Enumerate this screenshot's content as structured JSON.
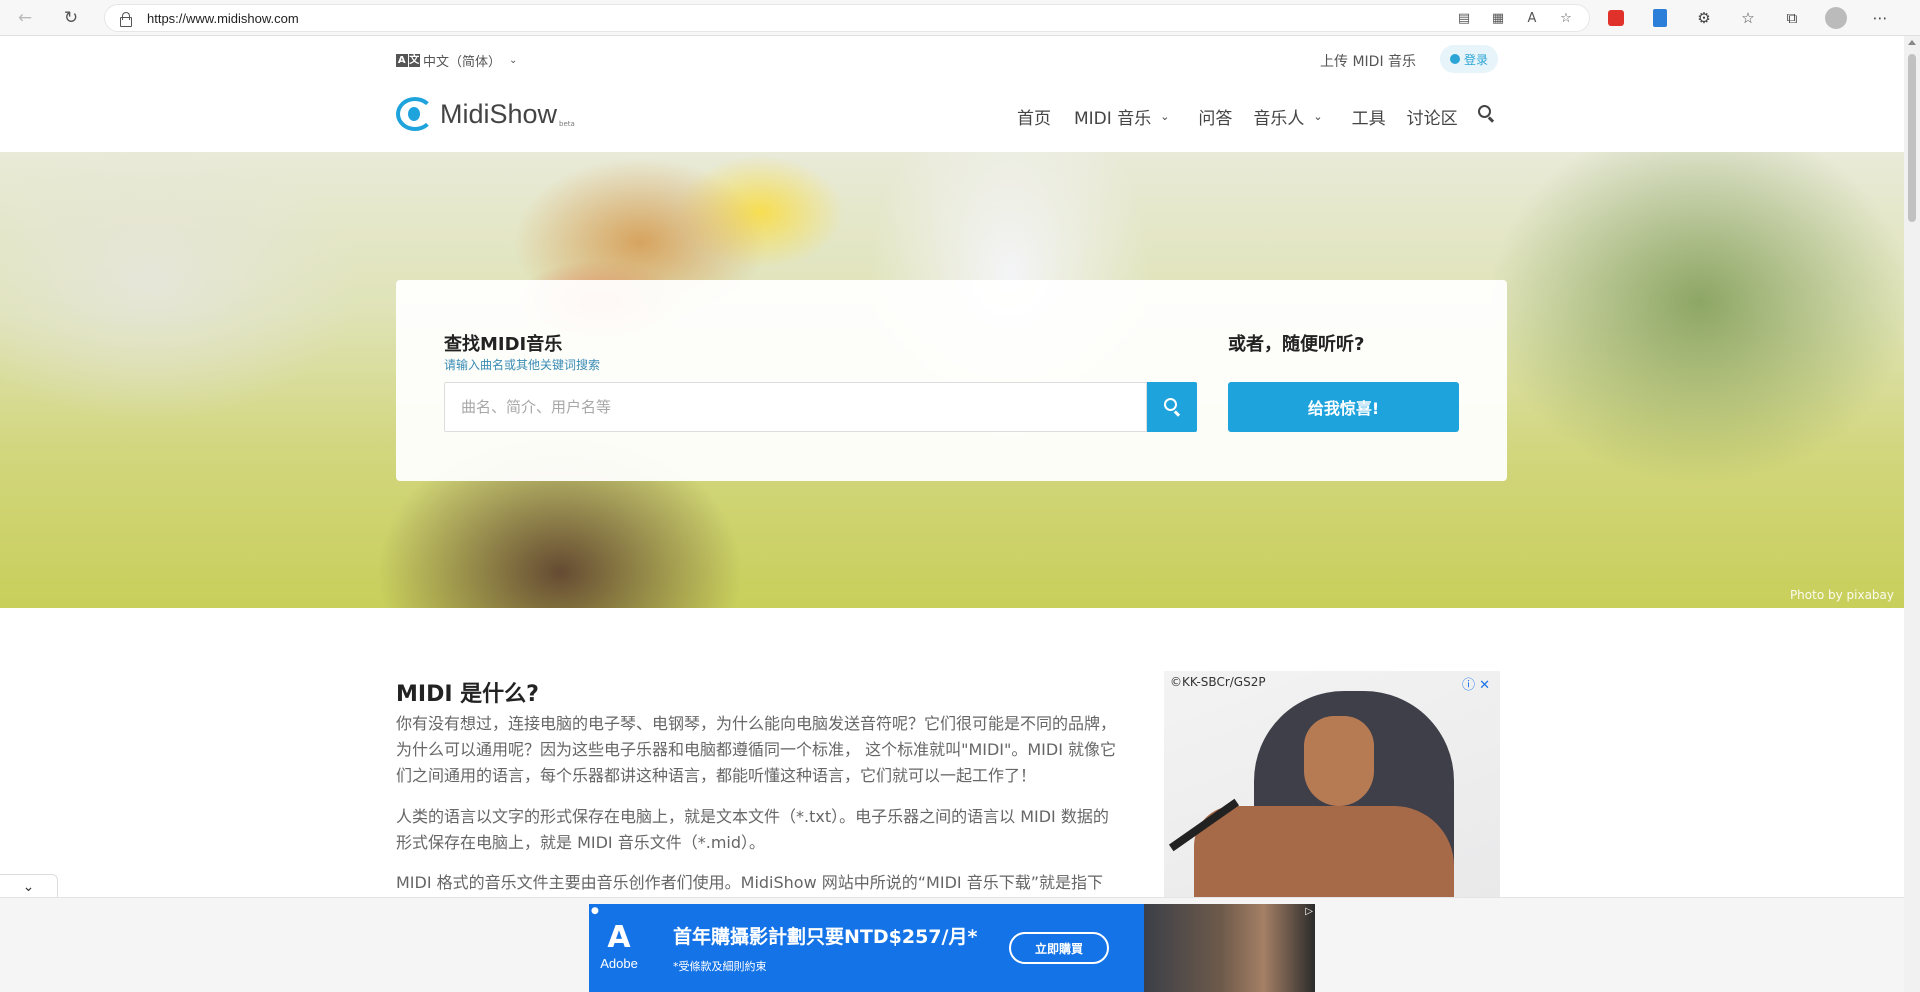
{
  "browser": {
    "url": "https://www.midishow.com",
    "icons": [
      "back-icon",
      "refresh-icon",
      "lock-icon",
      "immersive-reader-icon",
      "qr-icon",
      "read-aloud-icon",
      "favorite-add-icon",
      "extension-red-icon",
      "extension-blue-icon",
      "extensions-icon",
      "favorites-icon",
      "collections-icon",
      "profile-icon",
      "more-icon"
    ]
  },
  "topbar": {
    "language": "中文（简体）",
    "upload": "上传 MIDI 音乐",
    "login": "登录"
  },
  "logo": {
    "name": "MidiShow",
    "badge": "beta"
  },
  "nav": {
    "items": [
      {
        "label": "首页",
        "dropdown": false
      },
      {
        "label": "MIDI 音乐",
        "dropdown": true
      },
      {
        "label": "问答",
        "dropdown": false
      },
      {
        "label": "音乐人",
        "dropdown": true
      },
      {
        "label": "工具",
        "dropdown": false
      },
      {
        "label": "讨论区",
        "dropdown": false
      }
    ]
  },
  "hero": {
    "credit": "Photo by pixabay",
    "search_title": "查找MIDI音乐",
    "search_subtitle": "请输入曲名或其他关键词搜索",
    "search_placeholder": "曲名、简介、用户名等",
    "random_title": "或者，随便听听?",
    "random_button": "给我惊喜!"
  },
  "content": {
    "title": "MIDI 是什么?",
    "paragraphs": [
      "你有没有想过，连接电脑的电子琴、电钢琴，为什么能向电脑发送音符呢？它们很可能是不同的品牌，为什么可以通用呢？因为这些电子乐器和电脑都遵循同一个标准， 这个标准就叫\"MIDI\"。MIDI 就像它们之间通用的语言，每个乐器都讲这种语言，都能听懂这种语言，它们就可以一起工作了！",
      "人类的语言以文字的形式保存在电脑上，就是文本文件（*.txt）。电子乐器之间的语言以 MIDI 数据的形式保存在电脑上，就是 MIDI 音乐文件（*.mid）。",
      "MIDI 格式的音乐文件主要由音乐创作者们使用。MidiShow 网站中所说的“MIDI 音乐下载”就是指下"
    ]
  },
  "side_ad": {
    "credit": "©KK-SBCr/GS2P",
    "close": "ⓘ ✕"
  },
  "bottom_ad": {
    "brand": "Adobe",
    "headline": "首年購攝影計劃只要NTD$257/月*",
    "subline": "*受條款及細則約束",
    "cta": "立即購買"
  },
  "colors": {
    "accent": "#1fa3dc",
    "adobe_blue": "#1473e6"
  }
}
